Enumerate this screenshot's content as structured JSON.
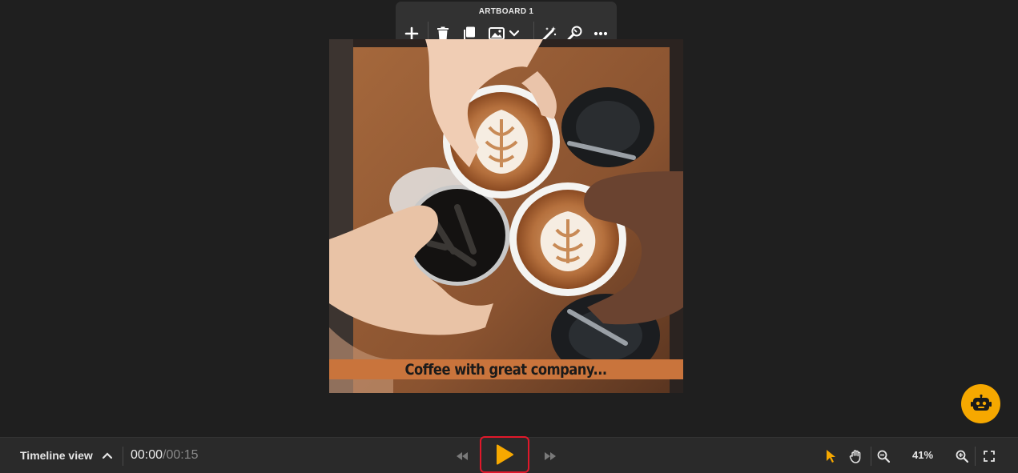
{
  "toolbar": {
    "title": "ARTBOARD 1",
    "icons": [
      "add-icon",
      "delete-icon",
      "duplicate-icon",
      "image-icon",
      "chevron-down-icon",
      "magic-wand-icon",
      "magic-brush-icon",
      "more-icon"
    ]
  },
  "artboard": {
    "caption": "Coffee with great company..."
  },
  "bottombar": {
    "timeline_label": "Timeline view",
    "time_current": "00:00",
    "time_separator": "/",
    "time_total": "00:15",
    "zoom_level": "41%"
  },
  "colors": {
    "accent": "#f6a800",
    "play_highlight": "#e0182a",
    "caption_bg": "#c9743c",
    "background": "#1f1f1f"
  }
}
